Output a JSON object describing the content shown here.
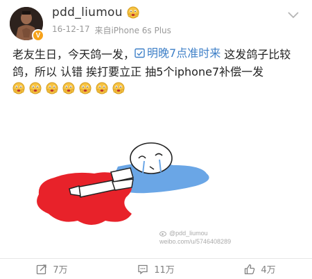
{
  "post": {
    "username": "pdd_liumou",
    "date": "16-12-17",
    "source": "来自iPhone 6s Plus",
    "badge": "V",
    "text_part1": "老友生日，今天鸽一发，",
    "link_text": "明晚7点准时来",
    "text_part2": " 这发鸽子比较鸽，所以 认错 挨打要立正 抽5个iphone7补偿一发",
    "emoji_count": 7
  },
  "watermark": {
    "line1": "@pdd_liumou",
    "line2": "weibo.com/u/5746408289"
  },
  "footer": {
    "repost_count": "7万",
    "comment_count": "11万",
    "like_count": "4万"
  },
  "colors": {
    "link": "#3d7fc7",
    "badge": "#f7a21a",
    "blood": "#e8222a",
    "water": "#6aa6e6"
  }
}
